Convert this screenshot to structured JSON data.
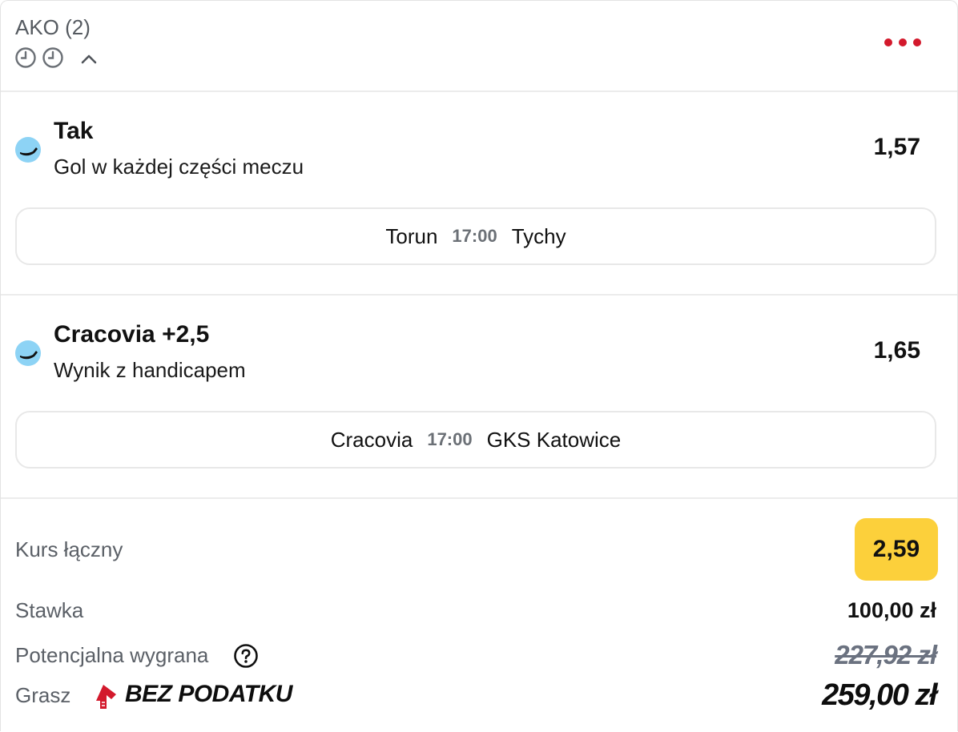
{
  "header": {
    "title": "AKO (2)",
    "icons": [
      "clock-icon",
      "clock-icon",
      "chevron-up-icon",
      "more-dots-icon"
    ],
    "accent_color": "#d3192c"
  },
  "selections": [
    {
      "pick": "Tak",
      "market": "Gol w każdej części meczu",
      "odds": "1,57",
      "home": "Torun",
      "time": "17:00",
      "away": "Tychy"
    },
    {
      "pick": "Cracovia +2,5",
      "market": "Wynik z handicapem",
      "odds": "1,65",
      "home": "Cracovia",
      "time": "17:00",
      "away": "GKS Katowice"
    }
  ],
  "summary": {
    "total_odds_label": "Kurs łączny",
    "total_odds": "2,59",
    "stake_label": "Stawka",
    "stake": "100,00 zł",
    "potential_label": "Potencjalna wygrana",
    "potential": "227,92 zł",
    "play_label": "Grasz",
    "tax_free_label": "BEZ PODATKU",
    "final_win": "259,00 zł",
    "badge_color": "#fcd03b"
  }
}
